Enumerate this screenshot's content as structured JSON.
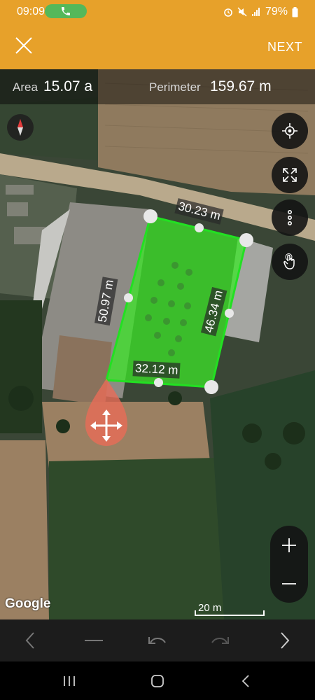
{
  "status": {
    "time": "09:09",
    "battery": "79%"
  },
  "toolbar": {
    "next_label": "NEXT"
  },
  "measure": {
    "area_label": "Area",
    "area_value": "15.07 a",
    "perimeter_label": "Perimeter",
    "perimeter_value": "159.67 m"
  },
  "edges": {
    "top": "30.23 m",
    "left": "50.97 m",
    "right": "46.34 m",
    "bottom": "32.12 m"
  },
  "map": {
    "attribution": "Google",
    "scale_label": "20 m"
  },
  "colors": {
    "brand": "#e7a12a",
    "polygon": "#22e022",
    "handle": "#e86b57"
  },
  "icons": [
    "close-icon",
    "compass-icon",
    "my-location-icon",
    "fullscreen-icon",
    "more-vert-icon",
    "touch-icon",
    "move-icon",
    "zoom-in-icon",
    "zoom-out-icon",
    "chevron-left-icon",
    "minus-icon",
    "undo-icon",
    "redo-icon",
    "chevron-right-icon"
  ]
}
